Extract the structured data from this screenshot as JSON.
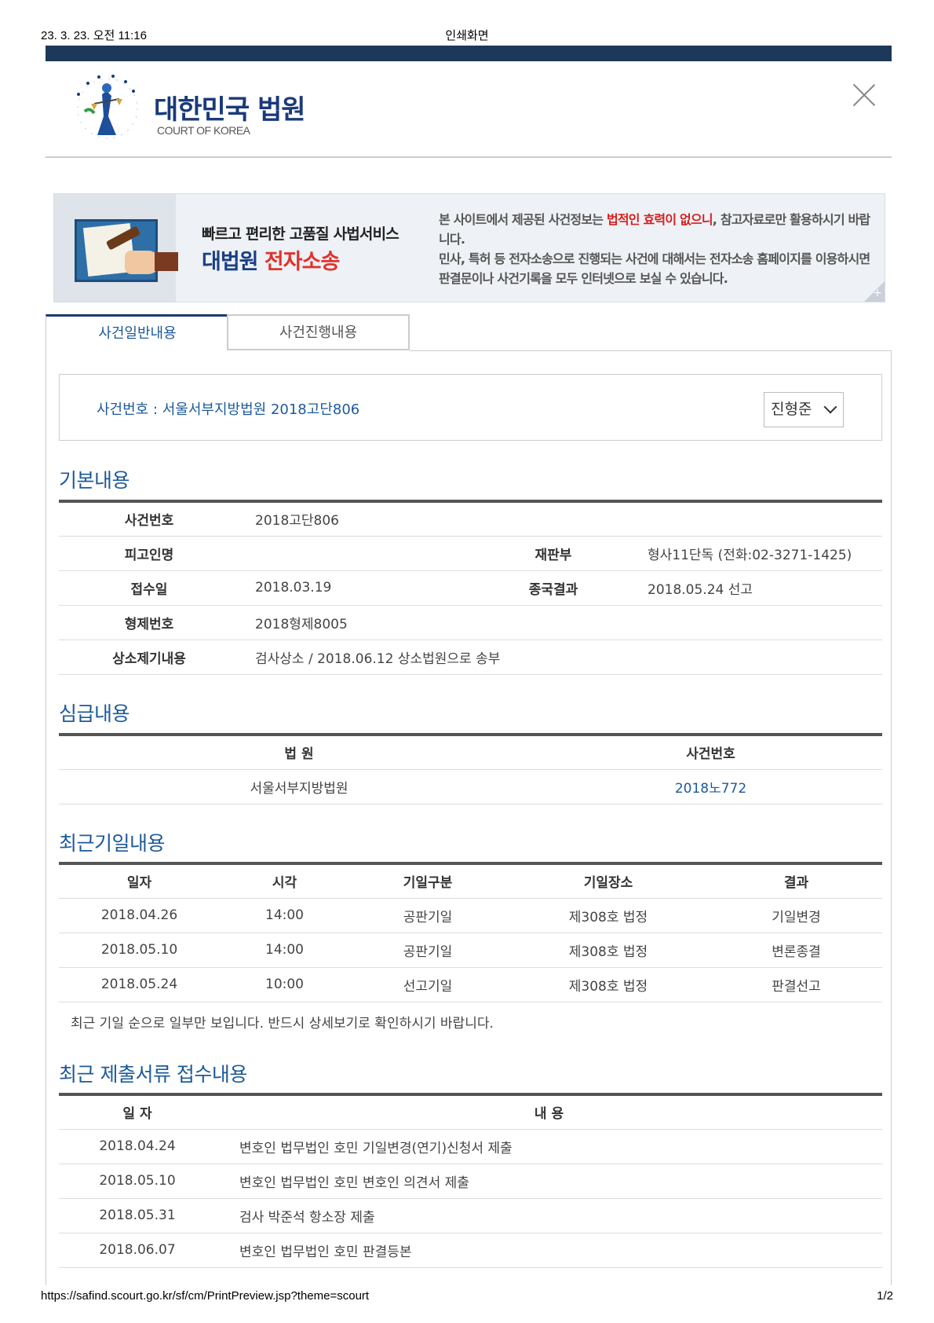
{
  "print_header": {
    "datetime": "23. 3. 23. 오전 11:16",
    "title": "인쇄화면"
  },
  "logo": {
    "korean": "대한민국 법원",
    "english": "COURT OF KOREA"
  },
  "banner": {
    "subtitle": "빠르고 편리한 고품질 사법서비스",
    "main_blue": "대법원 ",
    "main_red": "전자소송",
    "notice_part1": "본 사이트에서 제공된 사건정보는 ",
    "notice_red": "법적인 효력이 없으니",
    "notice_part2": ", 참고자료로만 활용하시기 바랍니다.",
    "notice_line2": "민사, 특허 등 전자소송으로 진행되는 사건에 대해서는 전자소송 홈페이지를 이용하시면 판결문이나 사건기록을 모두 인터넷으로 보실 수 있습니다.",
    "plus": "+"
  },
  "tabs": {
    "general": "사건일반내용",
    "progress": "사건진행내용"
  },
  "case_box": {
    "label": "사건번호 : 서울서부지방법원 2018고단806",
    "party": "진형준"
  },
  "basic": {
    "title": "기본내용",
    "case_no_label": "사건번호",
    "case_no": "2018고단806",
    "defendant_label": "피고인명",
    "defendant": "",
    "division_label": "재판부",
    "division": "형사11단독 (전화:02-3271-1425)",
    "receipt_label": "접수일",
    "receipt": "2018.03.19",
    "result_label": "종국결과",
    "result": "2018.05.24 선고",
    "related_label": "형제번호",
    "related": "2018형제8005",
    "appeal_label": "상소제기내용",
    "appeal": "검사상소 / 2018.06.12 상소법원으로 송부"
  },
  "appeal_court": {
    "title": "심급내용",
    "col_court": "법 원",
    "col_case": "사건번호",
    "court": "서울서부지방법원",
    "case": "2018노772"
  },
  "hearings": {
    "title": "최근기일내용",
    "headers": [
      "일자",
      "시각",
      "기일구분",
      "기일장소",
      "결과"
    ],
    "rows": [
      [
        "2018.04.26",
        "14:00",
        "공판기일",
        "제308호 법정",
        "기일변경"
      ],
      [
        "2018.05.10",
        "14:00",
        "공판기일",
        "제308호 법정",
        "변론종결"
      ],
      [
        "2018.05.24",
        "10:00",
        "선고기일",
        "제308호 법정",
        "판결선고"
      ]
    ],
    "note": "최근 기일 순으로 일부만 보입니다. 반드시 상세보기로 확인하시기 바랍니다."
  },
  "documents": {
    "title": "최근 제출서류 접수내용",
    "col_date": "일 자",
    "col_content": "내 용",
    "rows": [
      [
        "2018.04.24",
        "변호인 법무법인 호민 기일변경(연기)신청서 제출"
      ],
      [
        "2018.05.10",
        "변호인 법무법인 호민 변호인 의견서 제출"
      ],
      [
        "2018.05.31",
        "검사 박준석 항소장 제출"
      ],
      [
        "2018.06.07",
        "변호인 법무법인 호민 판결등본"
      ]
    ]
  },
  "print_footer": {
    "url": "https://safind.scourt.go.kr/sf/cm/PrintPreview.jsp?theme=scourt",
    "page": "1/2"
  },
  "colors": {
    "navy_bar": "#1c3959",
    "title_blue": "#1c5a9a",
    "alert_red": "#d61f1f"
  }
}
